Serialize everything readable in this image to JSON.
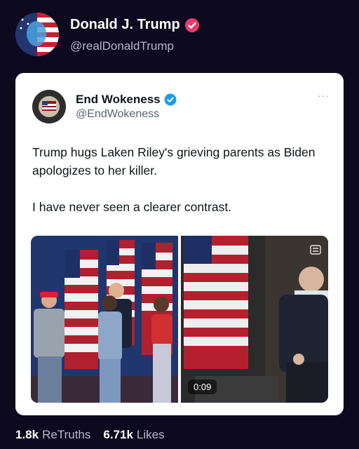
{
  "post": {
    "author_name": "Donald J. Trump",
    "author_handle": "@realDonaldTrump",
    "avatar_icon": "flag-face-avatar",
    "verified_color": "#e63b6b"
  },
  "quote": {
    "author_name": "End Wokeness",
    "author_handle": "@EndWokeness",
    "verified_color": "#1d9bf0",
    "more": "···",
    "text_1": "Trump hugs Laken Riley's grieving parents as Biden apologizes to her killer.",
    "text_2": "I have never seen a clearer contrast.",
    "media_left": "photo-trump-hugging-family",
    "media_right": "video-biden-interview",
    "video_duration": "0:09"
  },
  "stats": {
    "retruths_value": "1.8k",
    "retruths_label": "ReTruths",
    "likes_value": "6.71k",
    "likes_label": "Likes"
  }
}
